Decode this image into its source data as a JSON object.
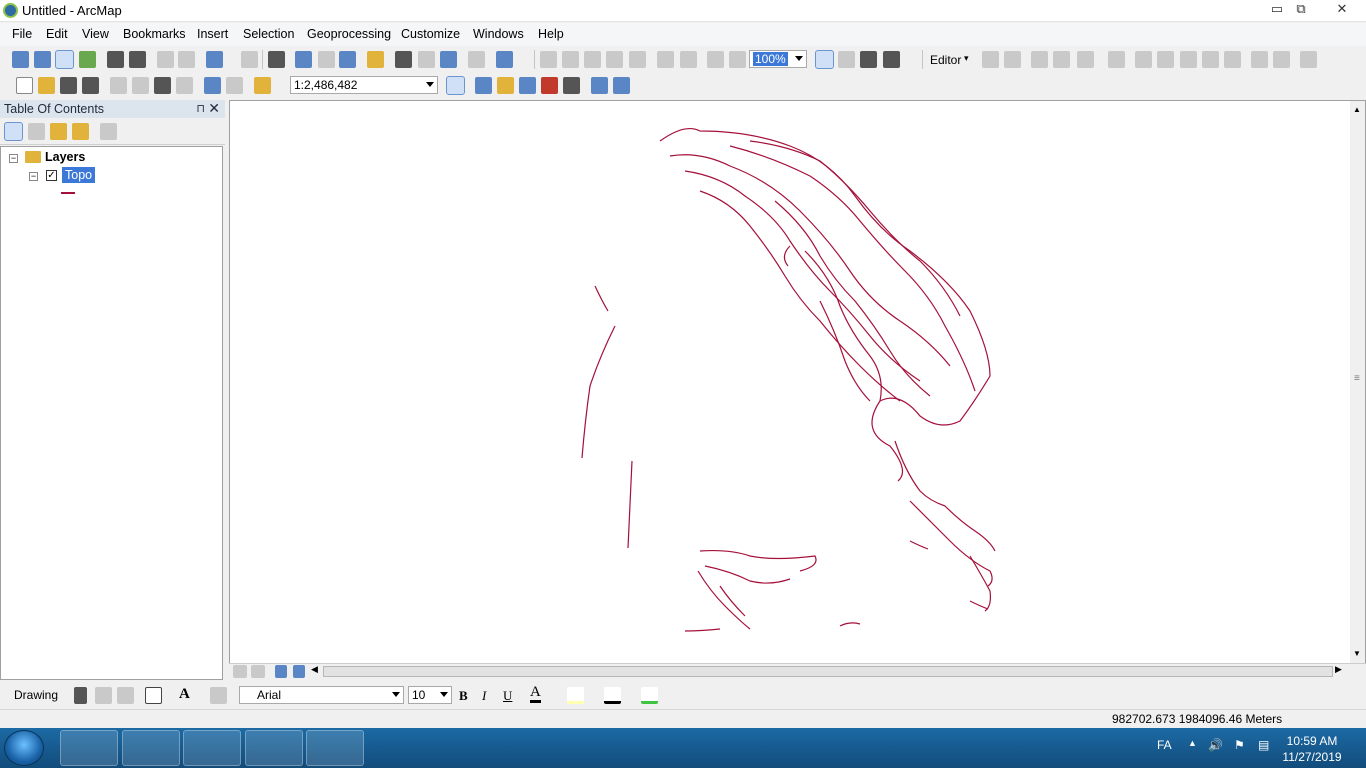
{
  "window": {
    "title": "Untitled - ArcMap",
    "minimize": "▭",
    "maximize": "⧉",
    "close": "✕"
  },
  "menu": [
    "File",
    "Edit",
    "View",
    "Bookmarks",
    "Insert",
    "Selection",
    "Geoprocessing",
    "Customize",
    "Windows",
    "Help"
  ],
  "toolbar": {
    "zoom_percent": "100%",
    "editor_label": "Editor",
    "scale_value": "1:2,486,482"
  },
  "toc": {
    "title": "Table Of Contents",
    "pin": "⊓",
    "close": "✕",
    "root_label": "Layers",
    "layer_label": "Topo",
    "layer_checked": "✓"
  },
  "map": {
    "line_color": "#a5103a"
  },
  "drawing": {
    "label": "Drawing",
    "font_name": "Arial",
    "font_size": "10",
    "bold": "B",
    "italic": "I",
    "underline": "U",
    "text_tool": "A",
    "font_color": "A"
  },
  "status": {
    "coordinates": "982702.673  1984096.46 Meters"
  },
  "taskbar": {
    "language": "FA",
    "time": "10:59 AM",
    "date": "11/27/2019"
  }
}
